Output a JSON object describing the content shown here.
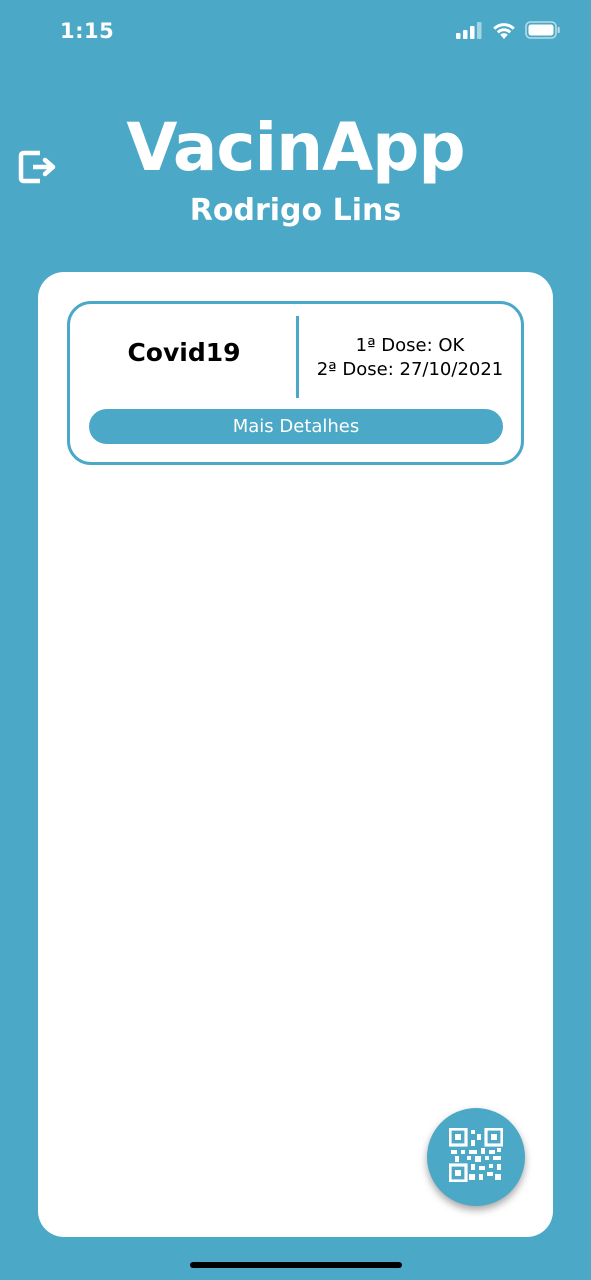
{
  "status_bar": {
    "time": "1:15",
    "icons": [
      "cellular-signal-icon",
      "wifi-icon",
      "battery-icon"
    ]
  },
  "header": {
    "title": "VacinApp",
    "user_name": "Rodrigo Lins",
    "logout_icon": "logout-icon"
  },
  "vaccines": [
    {
      "name": "Covid19",
      "dose1": "1ª Dose: OK",
      "dose2": "2ª Dose: 27/10/2021",
      "details_label": "Mais Detalhes"
    }
  ],
  "fab": {
    "icon": "qr-code-icon"
  },
  "colors": {
    "primary": "#4BA8C6",
    "panel": "#FFFFFF",
    "text": "#000000"
  }
}
